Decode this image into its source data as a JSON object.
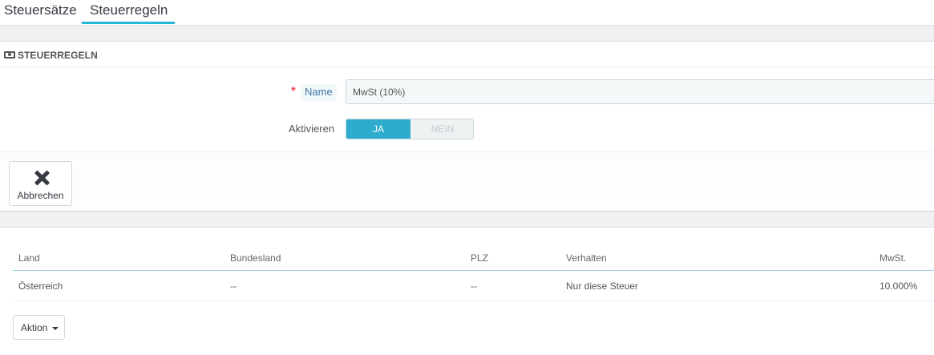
{
  "tabs": [
    {
      "label": "Steuersätze",
      "active": false
    },
    {
      "label": "Steuerregeln",
      "active": true
    }
  ],
  "panel": {
    "title": "STEUERREGELN",
    "icon": "money-icon",
    "name_required_mark": "*",
    "name_label": "Name",
    "name_value": "MwSt (10%)",
    "aktivieren_label": "Aktivieren",
    "switch_on": "JA",
    "switch_off": "NEIN",
    "switch_state": "JA"
  },
  "footer": {
    "cancel_label": "Abbrechen",
    "cancel_icon": "close-icon"
  },
  "table": {
    "columns": [
      "Land",
      "Bundesland",
      "PLZ",
      "Verhalten",
      "MwSt."
    ],
    "rows": [
      [
        "Österreich",
        "--",
        "--",
        "Nur diese Steuer",
        "10.000%"
      ]
    ]
  },
  "actions": {
    "aktion_label": "Aktion"
  },
  "colors": {
    "accent": "#25b9d7",
    "switch_active": "#2eacce",
    "required": "#e84e56"
  }
}
